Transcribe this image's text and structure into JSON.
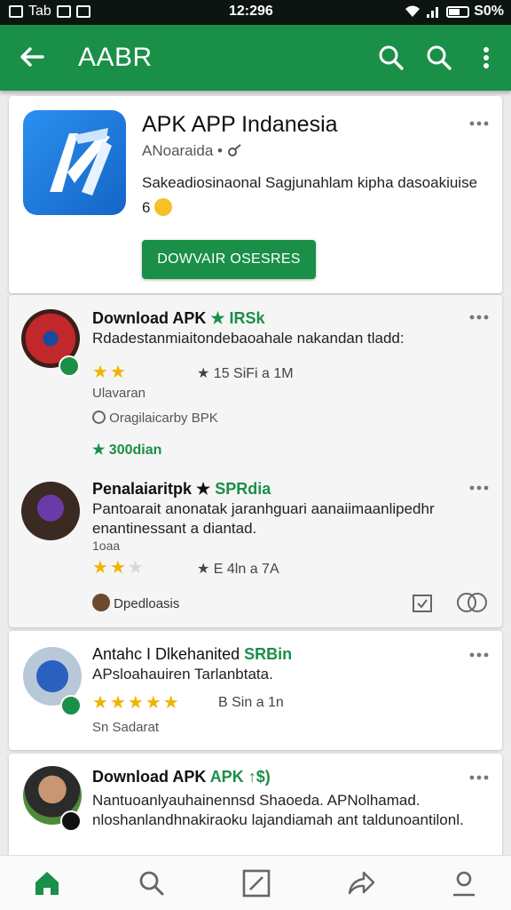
{
  "status_bar": {
    "left_text": "Tab",
    "time": "12:296",
    "battery": "S0%"
  },
  "app_bar": {
    "title": "AABR"
  },
  "app_card": {
    "name": "APK APP Indanesia",
    "developer": "ANoaraida •",
    "description": "Sakeadiosinaonal Sagjunahlam kipha dasoakiuise 6",
    "install_label": "DOWVAIR OSESRES"
  },
  "reviews": [
    {
      "title": "Download APK",
      "title_accent": "★ IRSk",
      "text": "Rdadestanmiaitondebaoahale nakandan tladd:",
      "stars_on": 2,
      "stat": "★ 15 SiFi a 1M",
      "meta": "Ulavaran",
      "source": "Oragilaicarby BPK",
      "extra": "★ 300dian",
      "colors": {
        "avatar": "#c0282c"
      }
    },
    {
      "title": "Penalaiaritpk ★",
      "title_accent": "SPRdia",
      "text": "Pantoarait anonatak jaranhguari aanaiimaanlipedhr enantinessant a diantad.",
      "meta": "1oaa",
      "stars_on": 2,
      "stat": "★ E 4ln a 7A",
      "source": "Dpedloasis"
    },
    {
      "title": "Antahc I Dlkehanited",
      "title_accent": "SRBin",
      "text": "APsloahauiren Tarlanbtata.",
      "stars_on": 5,
      "stat": "B Sin a 1n",
      "meta": "Sn Sadarat"
    },
    {
      "title": "Download APK",
      "title_accent": "APK ↑$)",
      "text": "Nantuoanlyauhainennsd Shaoeda. APNolhamad. nloshanlandhnakiraoku lajandiamah ant taldunoantilonl."
    }
  ],
  "icons": {
    "back": "arrow-left-icon",
    "search": "search-icon",
    "more": "more-vert-icon",
    "nav": [
      "home-icon",
      "search-icon",
      "edit-icon",
      "share-icon",
      "profile-icon"
    ]
  },
  "colors": {
    "brand": "#1a8f48",
    "star": "#f0b400",
    "status_bar": "#0d1512"
  }
}
